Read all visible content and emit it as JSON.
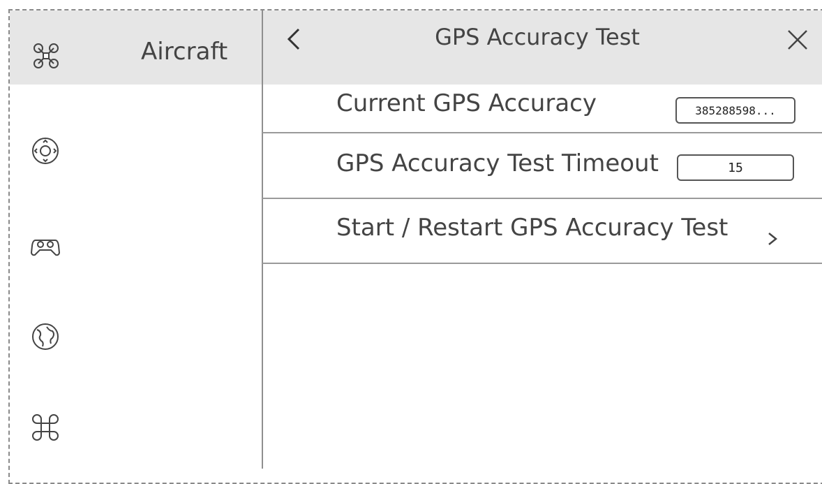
{
  "sidebar": {
    "title": "Aircraft",
    "icons": [
      "aircraft-icon",
      "control-icon",
      "gamepad-icon",
      "globe-icon",
      "command-icon"
    ]
  },
  "header": {
    "title": "GPS Accuracy Test",
    "back_icon": "chevron-left-icon",
    "close_icon": "close-icon"
  },
  "rows": [
    {
      "label": "Current GPS Accuracy",
      "value": "385288598..."
    },
    {
      "label": "GPS Accuracy Test Timeout",
      "value": "15"
    },
    {
      "label": "Start / Restart GPS Accuracy Test",
      "action_icon": "chevron-right-icon"
    }
  ],
  "colors": {
    "header_bg": "#e6e6e6",
    "text": "#444444",
    "divider": "#9a9a9a"
  }
}
